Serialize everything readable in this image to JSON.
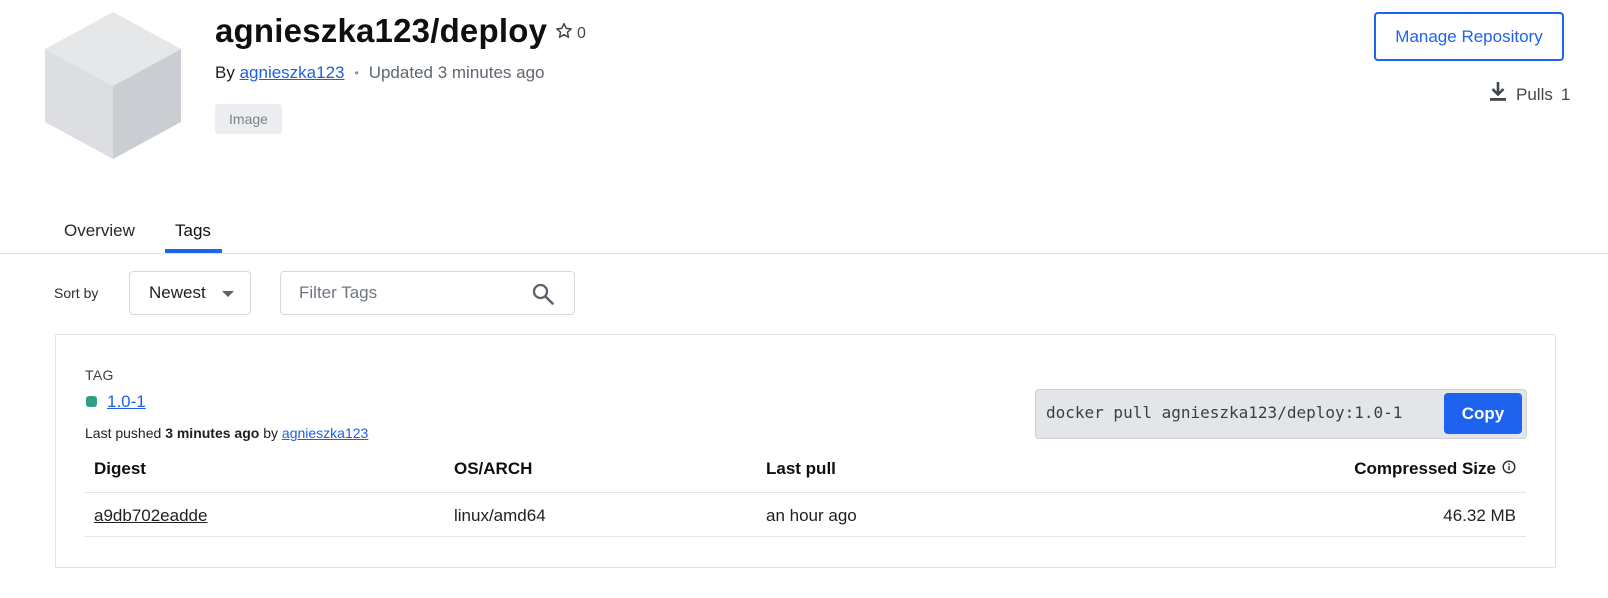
{
  "repo": {
    "title": "agnieszka123/deploy",
    "star_count": "0",
    "by_label": "By",
    "owner": "agnieszka123",
    "updated": "Updated 3 minutes ago",
    "type_badge": "Image"
  },
  "actions": {
    "manage_label": "Manage Repository",
    "pulls_label": "Pulls",
    "pulls_count": "1"
  },
  "tabs": [
    {
      "label": "Overview",
      "active": false
    },
    {
      "label": "Tags",
      "active": true
    }
  ],
  "controls": {
    "sort_label": "Sort by",
    "sort_value": "Newest",
    "filter_placeholder": "Filter Tags"
  },
  "tag_card": {
    "section_label": "TAG",
    "tag_name": "1.0-1",
    "status_color": "#2fa084",
    "pushed_prefix": "Last pushed",
    "pushed_time": "3 minutes ago",
    "pushed_by": "by",
    "pushed_user": "agnieszka123",
    "pull_command": "docker pull agnieszka123/deploy:1.0-1",
    "copy_label": "Copy",
    "columns": {
      "digest": "Digest",
      "os_arch": "OS/ARCH",
      "last_pull": "Last pull",
      "size": "Compressed Size"
    },
    "rows": [
      {
        "digest": "a9db702eadde",
        "os_arch": "linux/amd64",
        "last_pull": "an hour ago",
        "size": "46.32 MB"
      }
    ]
  },
  "colors": {
    "accent": "#1d63ed",
    "link": "#2060e0"
  }
}
